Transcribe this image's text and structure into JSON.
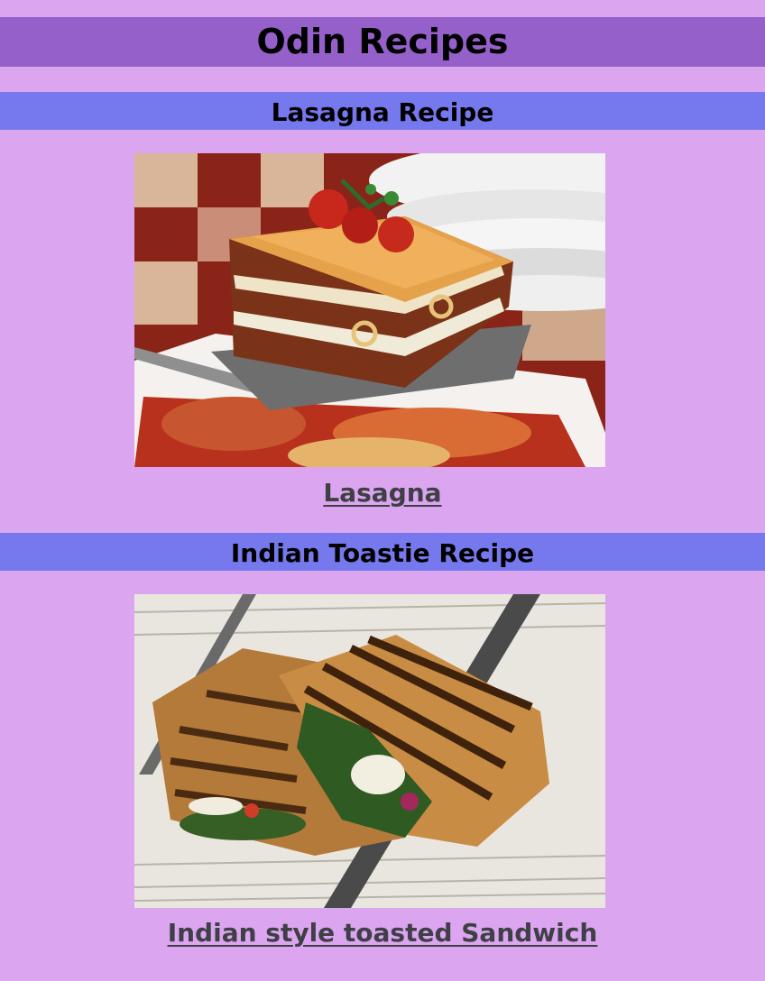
{
  "header": {
    "title": "Odin Recipes"
  },
  "recipes": [
    {
      "heading": "Lasagna Recipe",
      "link_text": "Lasagna"
    },
    {
      "heading": "Indian Toastie Recipe",
      "link_text": "Indian style toasted Sandwich"
    }
  ],
  "colors": {
    "page_background": "#dba5ef",
    "title_bar": "#9660cb",
    "section_bar": "#7679ee",
    "link_text": "#3f3f46"
  }
}
